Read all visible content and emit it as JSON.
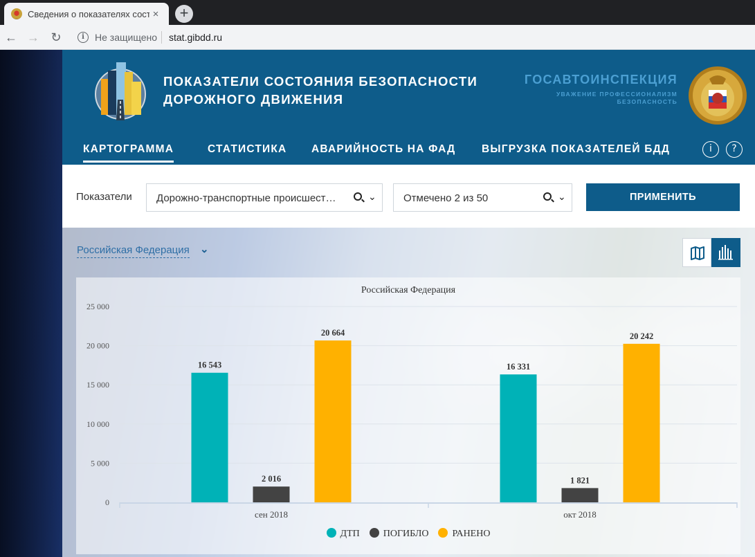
{
  "browser": {
    "tab_title": "Сведения о показателях состояния",
    "tab_close": "×",
    "new_tab": "+",
    "security_text": "Не защищено",
    "url": "stat.gibdd.ru"
  },
  "header": {
    "title_line1": "ПОКАЗАТЕЛИ СОСТОЯНИЯ БЕЗОПАСНОСТИ",
    "title_line2": "ДОРОЖНОГО ДВИЖЕНИЯ",
    "agency_name": "ГОСАВТОИНСПЕКЦИЯ",
    "agency_motto_line1": "УВАЖЕНИЕ ПРОФЕССИОНАЛИЗМ",
    "agency_motto_line2": "БЕЗОПАСНОСТЬ"
  },
  "nav": {
    "items": [
      {
        "label": "КАРТОГРАММА",
        "active": true
      },
      {
        "label": "СТАТИСТИКА",
        "active": false
      },
      {
        "label": "АВАРИЙНОСТЬ НА ФАД",
        "active": false
      },
      {
        "label": "ВЫГРУЗКА ПОКАЗАТЕЛЕЙ БДД",
        "active": false
      }
    ],
    "info_icon": "i",
    "help_icon": "?"
  },
  "filters": {
    "label": "Показатели",
    "indicator_value": "Дорожно-транспортные происшест…",
    "selection_value": "Отмечено 2 из 50",
    "apply_label": "ПРИМЕНИТЬ"
  },
  "content": {
    "region_label": "Российская Федерация"
  },
  "colors": {
    "brand": "#0e5c8a",
    "dtp": "#00b2b7",
    "killed": "#434343",
    "injured": "#ffb100"
  },
  "chart_data": {
    "type": "bar",
    "title": "Российская Федерация",
    "categories": [
      "сен 2018",
      "окт 2018"
    ],
    "series": [
      {
        "name": "ДТП",
        "color": "#00b2b7",
        "values": [
          16543,
          16331
        ],
        "labels": [
          "16 543",
          "16 331"
        ]
      },
      {
        "name": "ПОГИБЛО",
        "color": "#434343",
        "values": [
          2016,
          1821
        ],
        "labels": [
          "2 016",
          "1 821"
        ]
      },
      {
        "name": "РАНЕНО",
        "color": "#ffb100",
        "values": [
          20664,
          20242
        ],
        "labels": [
          "20 664",
          "20 242"
        ]
      }
    ],
    "yticks": [
      0,
      5000,
      10000,
      15000,
      20000,
      25000
    ],
    "ytick_labels": [
      "0",
      "5 000",
      "10 000",
      "15 000",
      "20 000",
      "25 000"
    ],
    "ylim": [
      0,
      25000
    ],
    "xlabel": "",
    "ylabel": "",
    "grid": true,
    "legend_position": "bottom-center"
  }
}
